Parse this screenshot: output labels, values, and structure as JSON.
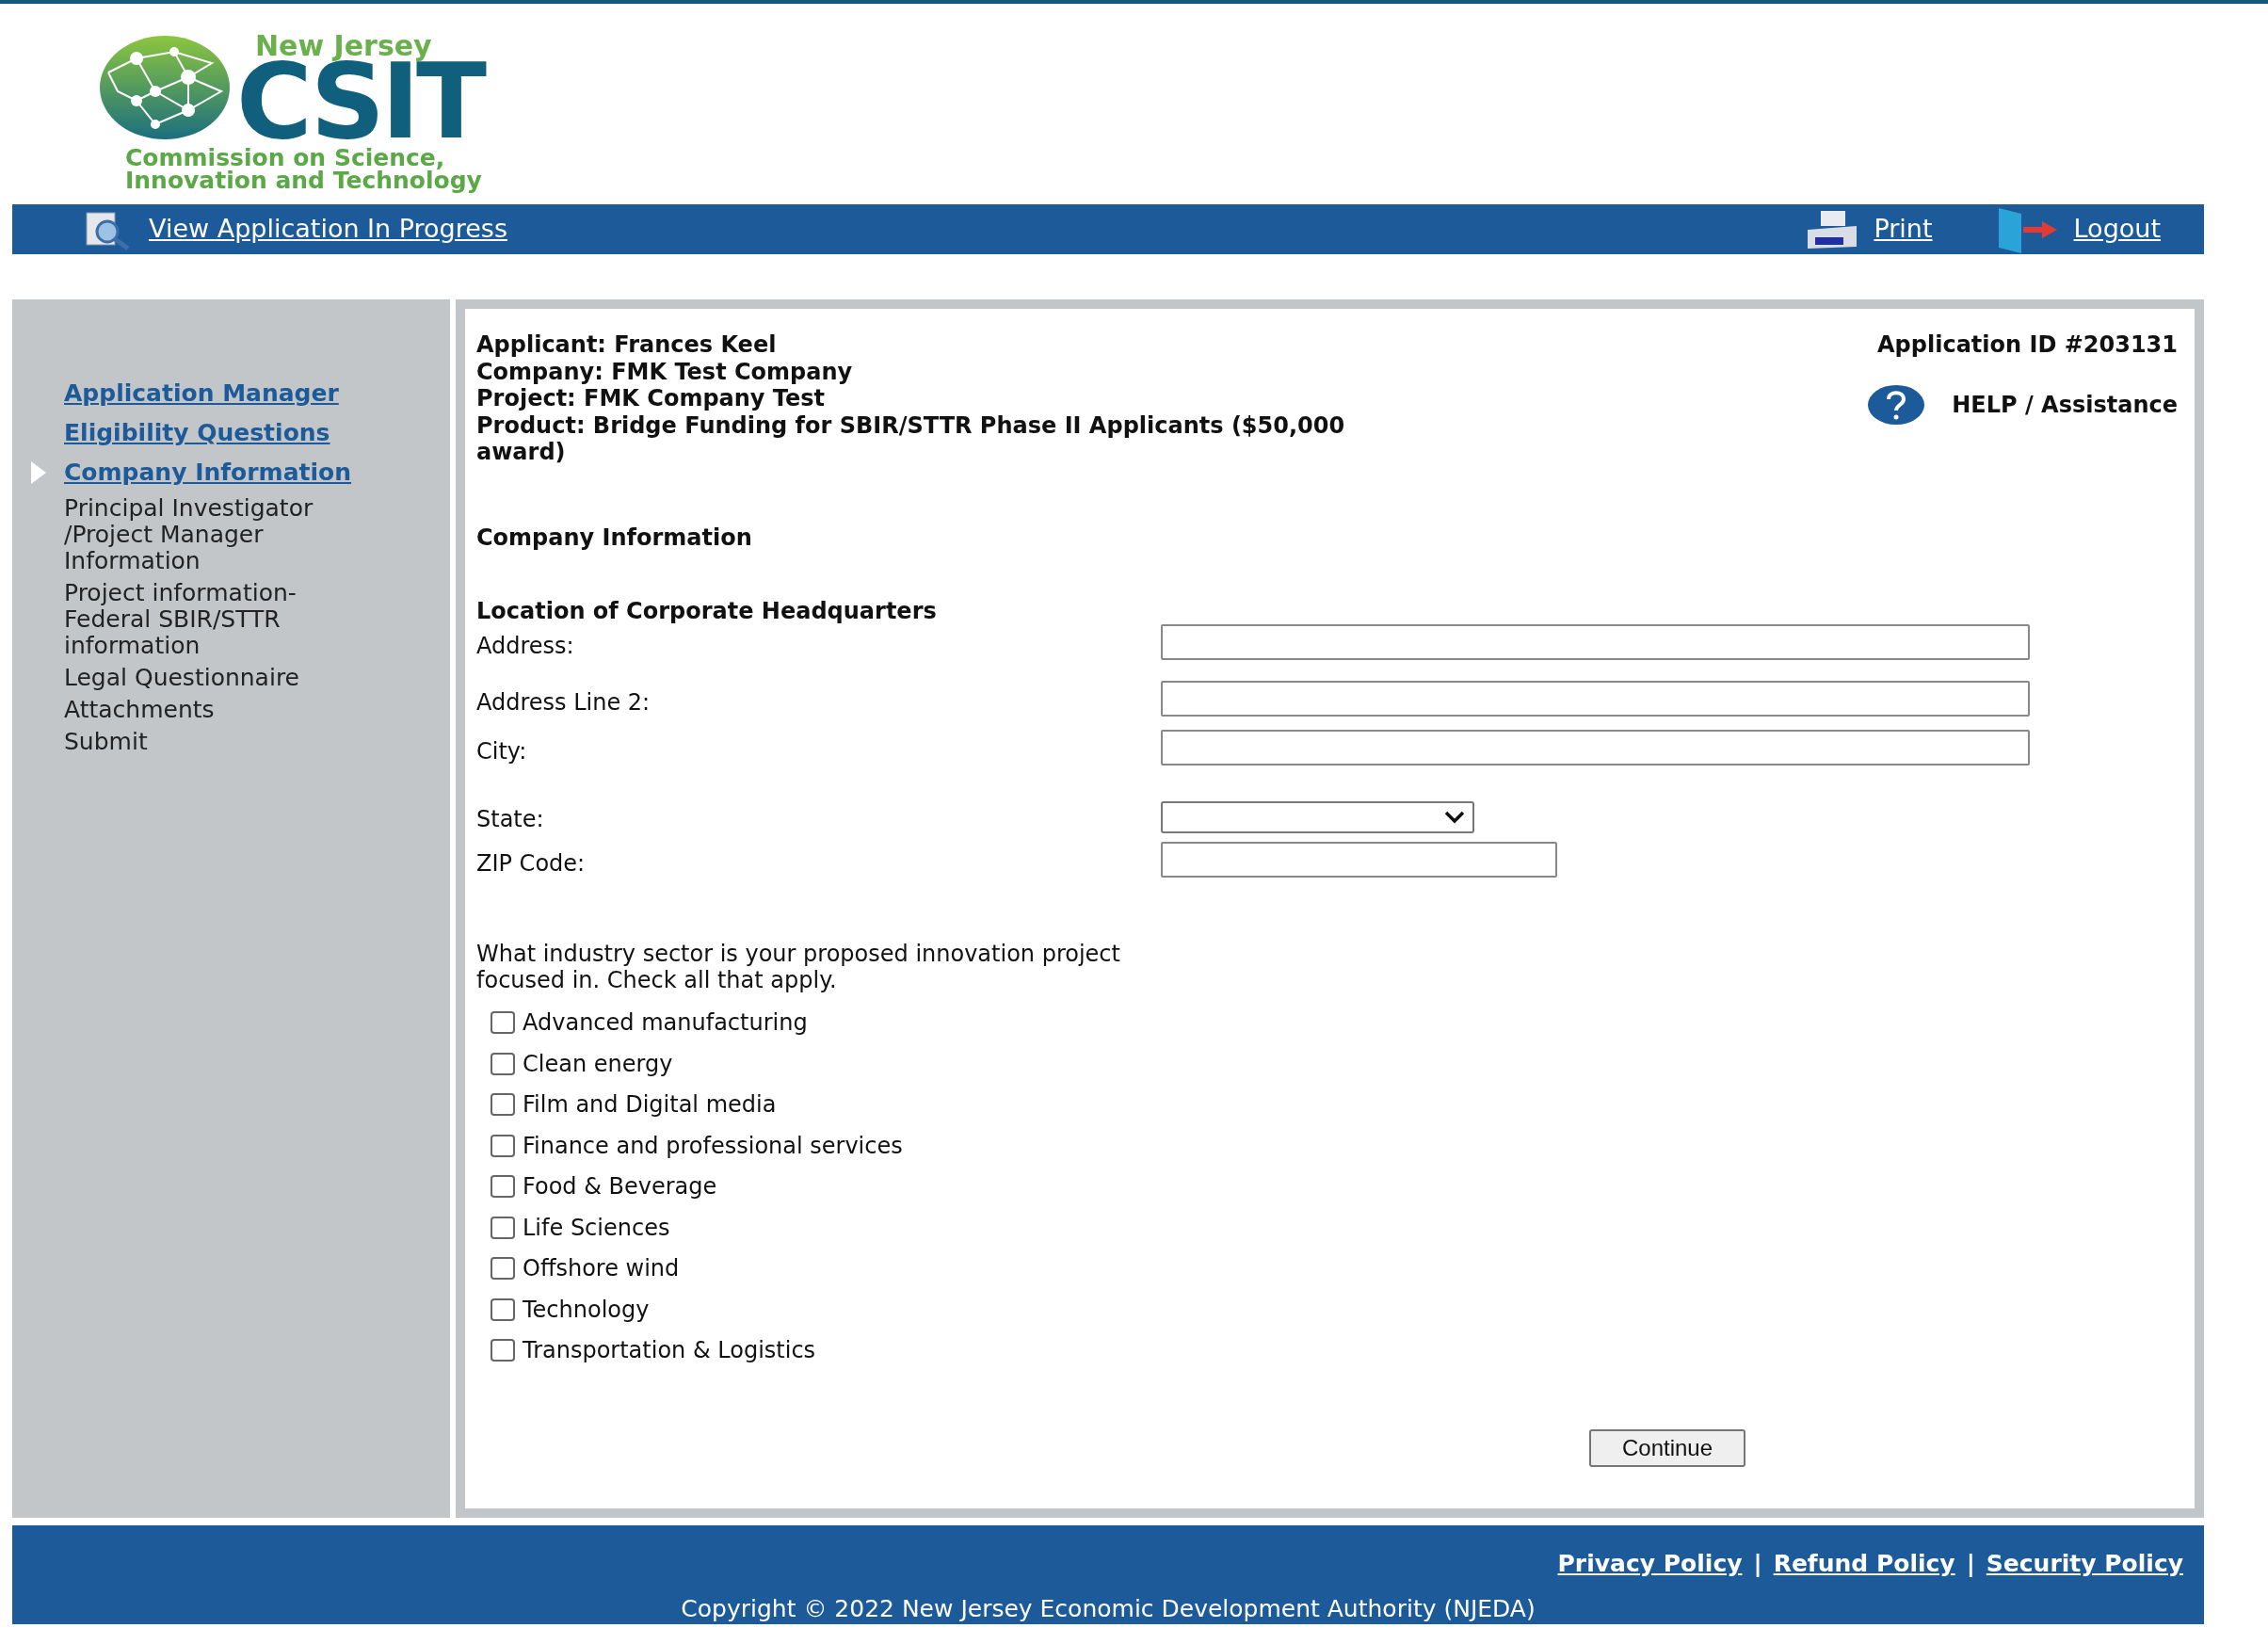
{
  "logo": {
    "top": "New Jersey",
    "mark": "CSIT",
    "line_1": "Commission on Science,",
    "line_2": "Innovation and Technology"
  },
  "nav": {
    "view_link": "View Application In Progress",
    "print": "Print",
    "logout": "Logout"
  },
  "sidebar": {
    "items": [
      {
        "label": "Application Manager",
        "kind": "link",
        "selected": false
      },
      {
        "label": "Eligibility Questions",
        "kind": "link",
        "selected": false
      },
      {
        "label": "Company Information",
        "kind": "link",
        "selected": true
      },
      {
        "label": "Principal Investigator /Project Manager Information",
        "kind": "text",
        "selected": false
      },
      {
        "label": "Project information-Federal SBIR/STTR information",
        "kind": "text",
        "selected": false
      },
      {
        "label": "Legal Questionnaire",
        "kind": "text",
        "selected": false
      },
      {
        "label": "Attachments",
        "kind": "text",
        "selected": false
      },
      {
        "label": "Submit",
        "kind": "text",
        "selected": false
      }
    ]
  },
  "info": {
    "lines": [
      "Applicant: Frances Keel",
      "Company: FMK Test Company",
      "Project: FMK Company Test",
      "Product: Bridge Funding for SBIR/STTR Phase II Applicants ($50,000 award)"
    ],
    "application_id": "Application ID #203131",
    "help": "HELP / Assistance"
  },
  "form": {
    "title": "Company Information",
    "section": "Location of Corporate Headquarters",
    "fields": [
      {
        "label": "Address:",
        "kind": "text"
      },
      {
        "label": "Address Line 2:",
        "kind": "text"
      },
      {
        "label": "City:",
        "kind": "text"
      },
      {
        "label": "State:",
        "kind": "select"
      },
      {
        "label": "ZIP Code:",
        "kind": "short"
      }
    ],
    "question": "What industry sector is your proposed innovation project focused in. Check all that apply.",
    "sectors": [
      {
        "label": "Advanced manufacturing",
        "checked": false
      },
      {
        "label": "Clean energy",
        "checked": false
      },
      {
        "label": "Film and Digital media",
        "checked": false
      },
      {
        "label": "Finance and professional services",
        "checked": false
      },
      {
        "label": "Food & Beverage",
        "checked": false
      },
      {
        "label": "Life Sciences",
        "checked": false
      },
      {
        "label": "Offshore wind",
        "checked": false
      },
      {
        "label": "Technology",
        "checked": false
      },
      {
        "label": "Transportation & Logistics",
        "checked": false
      }
    ],
    "button": "Continue"
  },
  "footer": {
    "links": [
      "Privacy Policy",
      "Refund Policy",
      "Security Policy"
    ],
    "separator": "|",
    "copyright": "Copyright © 2022 New Jersey Economic Development Authority (NJEDA)"
  }
}
